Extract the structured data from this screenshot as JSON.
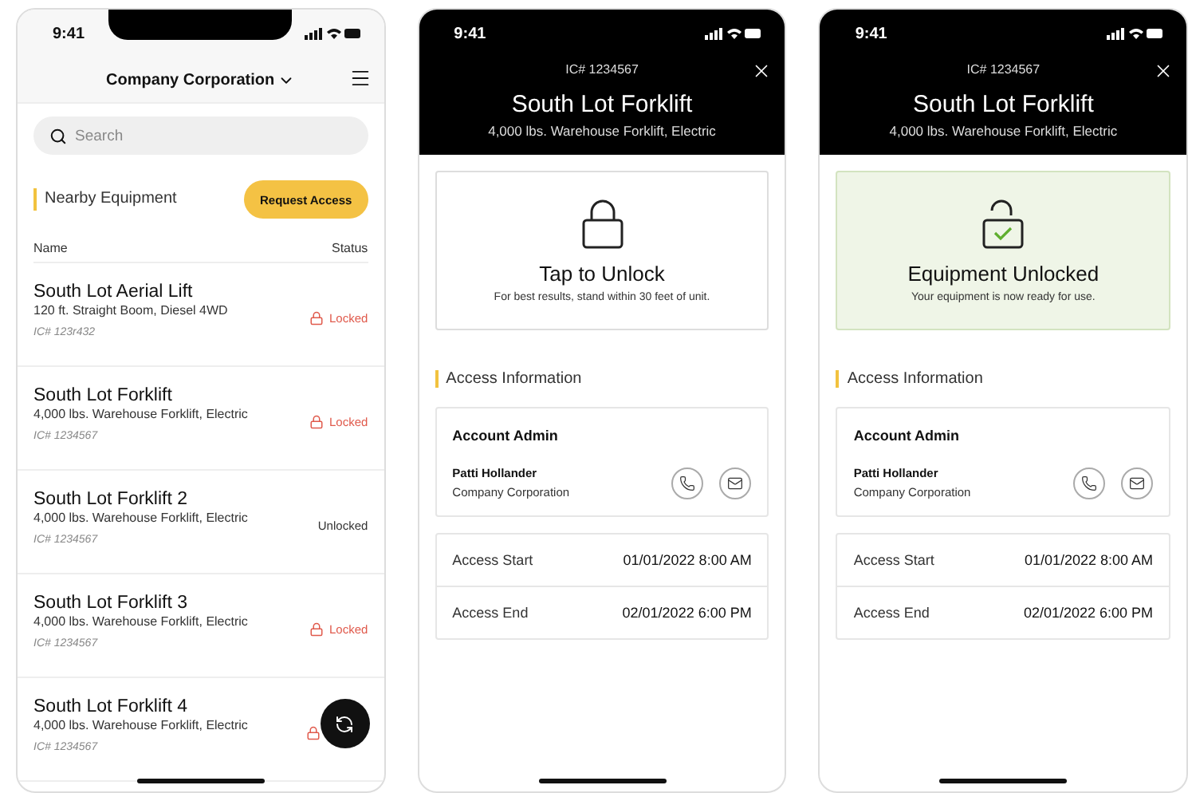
{
  "screens": [
    {
      "kind": "list",
      "status_time": "9:41",
      "header": {
        "title": "Company Corporation"
      },
      "search": {
        "placeholder": "Search"
      },
      "section_title": "Nearby Equipment",
      "action_button": "Request Access",
      "columns": [
        "Name",
        "Status"
      ],
      "rows": [
        {
          "name": "South Lot Aerial Lift",
          "description": "120 ft. Straight Boom, Diesel 4WD",
          "id": "IC# 123r432",
          "locked": true,
          "status": "Locked"
        },
        {
          "name": "South Lot Forklift",
          "description": "4,000 lbs. Warehouse Forklift, Electric",
          "id": "IC# 1234567",
          "locked": true,
          "status": "Locked"
        },
        {
          "name": "South Lot Forklift 2",
          "description": "4,000 lbs. Warehouse Forklift, Electric",
          "id": "IC# 1234567",
          "locked": false,
          "status": "Unlocked"
        },
        {
          "name": "South Lot Forklift 3",
          "description": "4,000 lbs. Warehouse Forklift, Electric",
          "id": "IC# 1234567",
          "locked": true,
          "status": "Locked"
        },
        {
          "name": "South Lot Forklift 4",
          "description": "4,000 lbs. Warehouse Forklift, Electric",
          "id": "IC# 1234567",
          "locked": true
        }
      ]
    },
    {
      "kind": "detail",
      "status_time": "9:41",
      "id_label": "IC# 1234567",
      "title": "South Lot Forklift",
      "subtitle": "4,000 lbs. Warehouse Forklift, Electric",
      "unlock_card": {
        "unlocked": false,
        "title": "Tap to Unlock",
        "message": "For best results, stand within 30 feet of unit."
      },
      "section_title": "Access Information",
      "admin": {
        "heading": "Account Admin",
        "name": "Patti Hollander",
        "company": "Company Corporation"
      },
      "access": [
        {
          "label": "Access Start",
          "value": "01/01/2022 8:00 AM"
        },
        {
          "label": "Access End",
          "value": "02/01/2022 6:00 PM"
        }
      ]
    },
    {
      "kind": "detail",
      "status_time": "9:41",
      "id_label": "IC# 1234567",
      "title": "South Lot Forklift",
      "subtitle": "4,000 lbs. Warehouse Forklift, Electric",
      "unlock_card": {
        "unlocked": true,
        "title": "Equipment Unlocked",
        "message": "Your equipment is now ready for use."
      },
      "section_title": "Access Information",
      "admin": {
        "heading": "Account Admin",
        "name": "Patti Hollander",
        "company": "Company Corporation"
      },
      "access": [
        {
          "label": "Access Start",
          "value": "01/01/2022 8:00 AM"
        },
        {
          "label": "Access End",
          "value": "02/01/2022 6:00 PM"
        }
      ]
    }
  ]
}
